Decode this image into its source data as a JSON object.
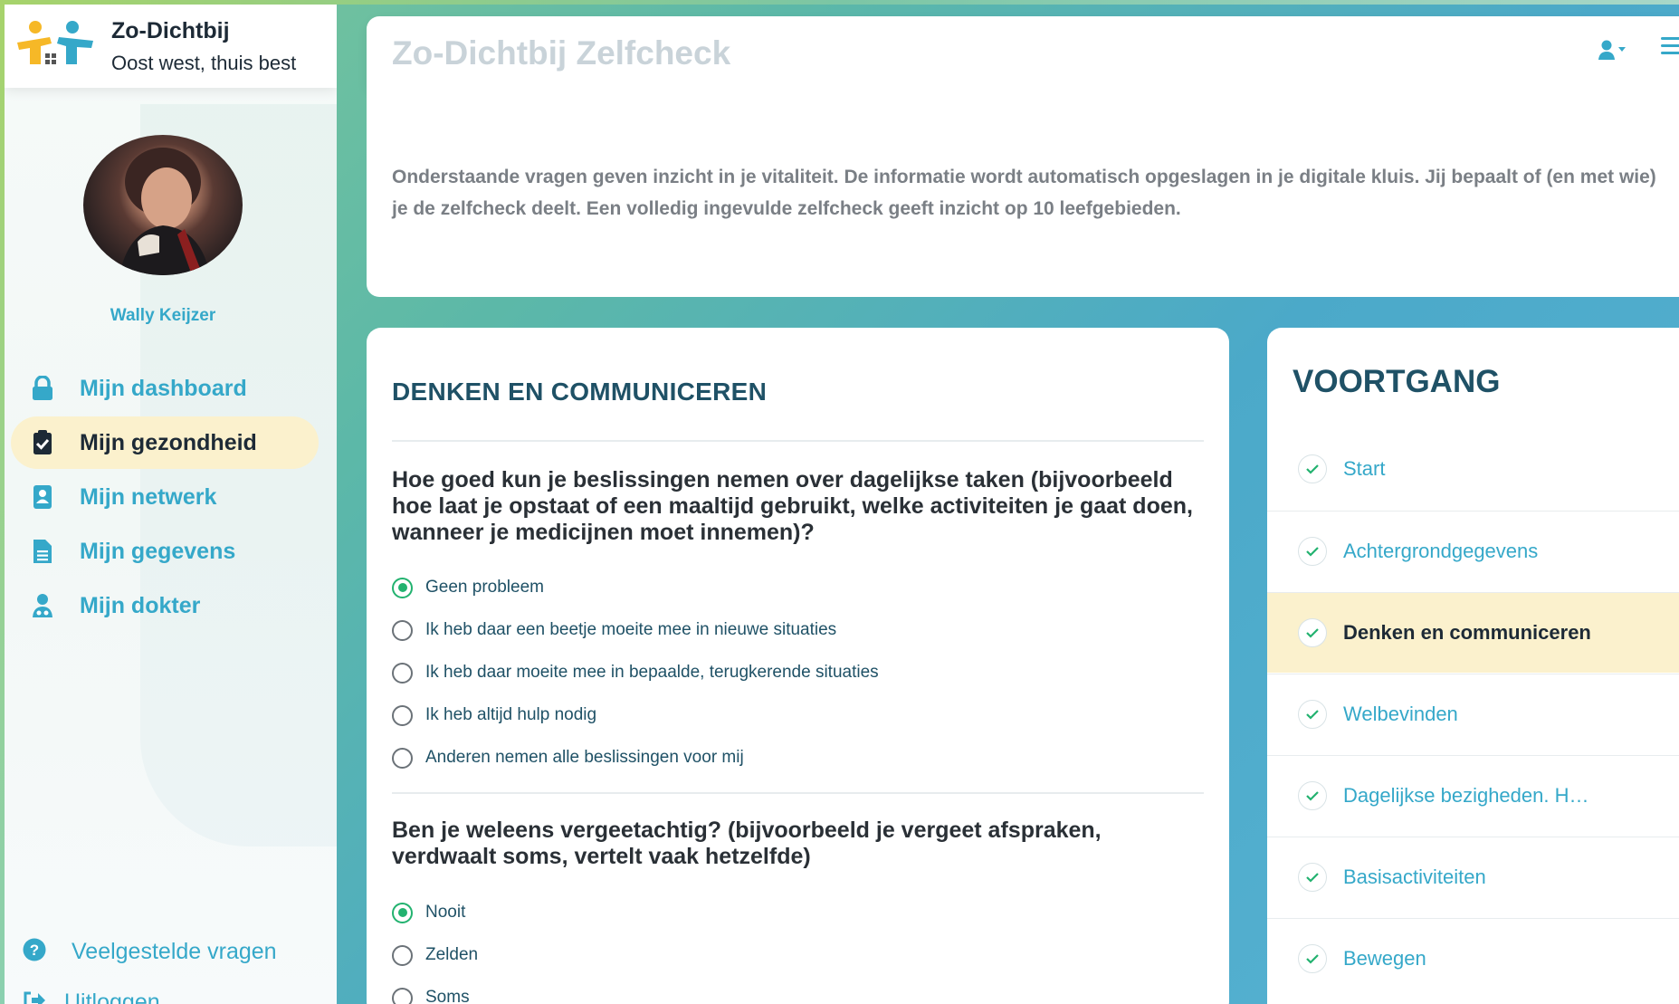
{
  "brand": {
    "title": "Zo-Dichtbij",
    "subtitle": "Oost west, thuis best"
  },
  "user": {
    "name": "Wally Keijzer"
  },
  "nav": [
    {
      "label": "Mijn dashboard",
      "icon": "lock-icon",
      "active": false
    },
    {
      "label": "Mijn gezondheid",
      "icon": "clipboard-check-icon",
      "active": true
    },
    {
      "label": "Mijn netwerk",
      "icon": "contact-book-icon",
      "active": false
    },
    {
      "label": "Mijn gegevens",
      "icon": "file-text-icon",
      "active": false
    },
    {
      "label": "Mijn dokter",
      "icon": "doctor-icon",
      "active": false
    }
  ],
  "bottom_links": {
    "faq": "Veelgestelde vragen",
    "logout": "Uitloggen"
  },
  "header": {
    "title": "Zo-Dichtbij Zelfcheck"
  },
  "intro": {
    "text": "Onderstaande vragen geven inzicht in je vitaliteit. De informatie wordt automatisch opgeslagen in je digitale kluis. Jij bepaalt of (en met wie) je de zelfcheck deelt. Een volledig ingevulde zelfcheck geeft inzicht op 10 leefgebieden."
  },
  "section": {
    "title": "DENKEN EN COMMUNICEREN",
    "questions": [
      {
        "text": "Hoe goed kun je beslissingen nemen over dagelijkse taken (bijvoorbeeld hoe laat je opstaat of een maaltijd gebruikt, welke activiteiten je gaat doen, wanneer je medicijnen moet innemen)?",
        "options": [
          "Geen probleem",
          "Ik heb daar een beetje moeite mee in nieuwe situaties",
          "Ik heb daar moeite mee in bepaalde, terugkerende situaties",
          "Ik heb altijd hulp nodig",
          "Anderen nemen alle beslissingen voor mij"
        ],
        "selected": 0
      },
      {
        "text": "Ben je weleens vergeetachtig? (bijvoorbeeld je vergeet afspraken, verdwaalt soms, vertelt vaak hetzelfde)",
        "options": [
          "Nooit",
          "Zelden",
          "Soms"
        ],
        "selected": 0
      }
    ]
  },
  "progress": {
    "title": "VOORTGANG",
    "steps": [
      {
        "label": "Start",
        "active": false
      },
      {
        "label": "Achtergrondgegevens",
        "active": false
      },
      {
        "label": "Denken en communiceren",
        "active": true
      },
      {
        "label": "Welbevinden",
        "active": false
      },
      {
        "label": "Dagelijkse bezigheden. H…",
        "active": false
      },
      {
        "label": "Basisactiviteiten",
        "active": false
      },
      {
        "label": "Bewegen",
        "active": false
      }
    ]
  },
  "colors": {
    "accent": "#35a8c9",
    "heading": "#1f5166",
    "active_bg": "#fbf1cd",
    "radio_checked": "#22b26f",
    "logo_yellow": "#f6b827"
  }
}
